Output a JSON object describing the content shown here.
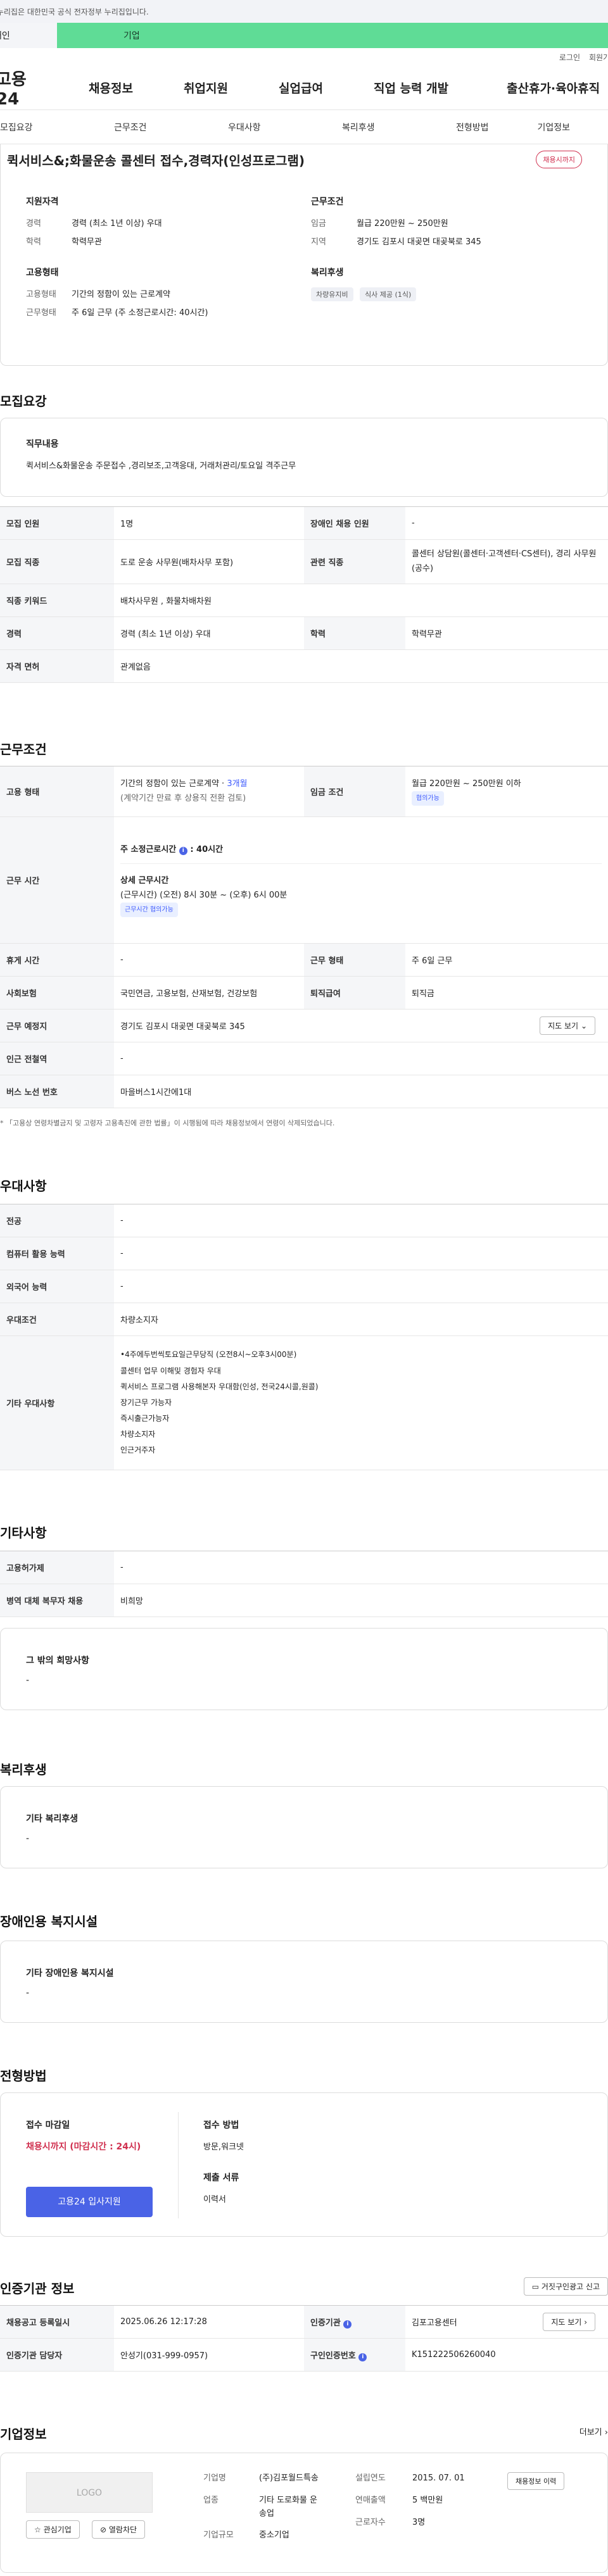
{
  "gov_banner": "이 누리집은 대한민국 공식 전자정부 누리집입니다.",
  "user_tabs": {
    "individual": "개인",
    "corporate": "기업"
  },
  "util_links": [
    "로그인",
    "회원가입"
  ],
  "logo": "고용24",
  "gnb": [
    "채용정보",
    "취업지원",
    "실업급여",
    "직업 능력 개발",
    "출산휴가·육아휴직"
  ],
  "subnav": [
    "모집요강",
    "근무조건",
    "우대사항",
    "복리후생",
    "전형방법",
    "기업정보"
  ],
  "job": {
    "title": "퀵서비스&;화물운송 콜센터 접수,경력자(인성프로그램)",
    "badge": "채용시까지",
    "qual_h": "지원자격",
    "qual": [
      {
        "k": "경력",
        "v": "경력 (최소 1년 이상) 우대"
      },
      {
        "k": "학력",
        "v": "학력무관"
      }
    ],
    "cond_h": "근무조건",
    "cond": [
      {
        "k": "임금",
        "v": "월급 220만원 ~ 250만원"
      },
      {
        "k": "지역",
        "v": "경기도 김포시 대곶면 대곶북로 345"
      }
    ],
    "emp_h": "고용형태",
    "emp": [
      {
        "k": "고용형태",
        "v": "기간의 정함이 있는 근로계약"
      },
      {
        "k": "근무형태",
        "v": "주 6일 근무 (주 소정근로시간: 40시간)"
      }
    ],
    "welfare_h": "복리후생",
    "welfare_chips": [
      "차량유지비",
      "식사 제공 (1식)"
    ]
  },
  "recruit": {
    "title": "모집요강",
    "duty_h": "직무내용",
    "duty": "퀵서비스&화물운송 주문접수 ,경리보조,고객응대, 거래처관리/토요일 격주근무",
    "rows": [
      {
        "k1": "모집 인원",
        "v1": "1명",
        "k2": "장애인 채용 인원",
        "v2": "-"
      },
      {
        "k1": "모집 직종",
        "v1": "도로 운송 사무원(배차사무 포함)",
        "k2": "관련 직종",
        "v2": "콜센터 상담원(콜센터·고객센터·CS센터), 경리 사무원(공수)"
      },
      {
        "k1": "직종 키워드",
        "v1": "배차사무원 , 화물차배차원"
      },
      {
        "k1": "경력",
        "v1": "경력 (최소 1년 이상) 우대",
        "k2": "학력",
        "v2": "학력무관"
      },
      {
        "k1": "자격 면허",
        "v1": "관계없음"
      }
    ]
  },
  "work": {
    "title": "근무조건",
    "emp_type_k": "고용 형태",
    "emp_type_v": "기간의 정함이 있는 근로계약 · ",
    "emp_type_months": "3개월",
    "emp_type_note": "(계약기간 만료 후 상용직 전환 검토)",
    "wage_k": "임금 조건",
    "wage_v": "월급 220만원 ~ 250만원 이하",
    "wage_chip": "협의가능",
    "hours_k": "근무 시간",
    "hours_main": "주 소정근로시간",
    "hours_val": ": 40시간",
    "hours_detail_h": "상세 근무시간",
    "hours_detail": "(근무시간) (오전) 8시 30분 ~ (오후) 6시 00분",
    "hours_chip": "근무시간 협의가능",
    "rest_k": "휴게 시간",
    "rest_v": "-",
    "type_k": "근무 형태",
    "type_v": "주 6일 근무",
    "ins_k": "사회보험",
    "ins_v": "국민연금, 고용보험, 산재보험, 건강보험",
    "sev_k": "퇴직급여",
    "sev_v": "퇴직금",
    "place_k": "근무 예정지",
    "place_v": "경기도 김포시 대곶면 대곶북로 345",
    "map_btn": "지도 보기",
    "station_k": "인근 전철역",
    "station_v": "-",
    "bus_k": "버스 노선 번호",
    "bus_v": "마을버스1시간에1대",
    "notice": "「고용상 연령차별금지 및 고령자 고용촉진에 관한 법률」이 시행됨에 따라 채용정보에서 연령이 삭제되었습니다."
  },
  "pref": {
    "title": "우대사항",
    "rows": [
      {
        "k": "전공",
        "v": "-"
      },
      {
        "k": "컴퓨터 활용 능력",
        "v": "-"
      },
      {
        "k": "외국어 능력",
        "v": "-"
      },
      {
        "k": "우대조건",
        "v": "차량소지자"
      }
    ],
    "etc_k": "기타 우대사항",
    "etc": [
      "•4주에두번씩토요일근무당직 (오전8시~오후3시00분)",
      "콜센터 업무 이해및 경험자 우대",
      "퀵서비스 프로그램 사용해본자 우대함(인성, 전국24시콜,원콜)",
      "장기근무 가능자",
      "즉시출근가능자",
      "차량소지자",
      "인근거주자"
    ]
  },
  "other": {
    "title": "기타사항",
    "rows": [
      {
        "k": "고용허가제",
        "v": "-"
      },
      {
        "k": "병역 대체 복무자 채용",
        "v": "비희망"
      }
    ],
    "hope_h": "그 밖의 희망사항",
    "hope_v": "-"
  },
  "welfare": {
    "title": "복리후생",
    "box_h": "기타 복리후생",
    "box_v": "-"
  },
  "disability": {
    "title": "장애인용 복지시설",
    "box_h": "기타 장애인용 복지시설",
    "box_v": "-"
  },
  "process": {
    "title": "전형방법",
    "deadline_h": "접수 마감일",
    "deadline_v": "채용시까지 (마감시간 : 24시)",
    "apply_btn": "고용24 입사지원",
    "method_h": "접수 방법",
    "method_v": "방문,워크넷",
    "docs_h": "제출 서류",
    "docs_v": "이력서"
  },
  "agency": {
    "title": "인증기관 정보",
    "report_btn": "거짓구인광고 신고",
    "reg_k": "채용공고 등록일시",
    "reg_v": "2025.06.26 12:17:28",
    "org_k": "인증기관",
    "org_v": "김포고용센터",
    "map_btn": "지도 보기",
    "mgr_k": "인증기관 담당자",
    "mgr_v": "안성기(031-999-0957)",
    "no_k": "구인인증번호",
    "no_v": "K151222506260040"
  },
  "company": {
    "title": "기업정보",
    "more": "더보기",
    "logo": "LOGO",
    "fav_btn": "관심기업",
    "block_btn": "열람차단",
    "name_k": "기업명",
    "name_v": "(주)김포월드특송",
    "industry_k": "업종",
    "industry_v": "기타 도로화물 운송업",
    "size_k": "기업규모",
    "size_v": "중소기업",
    "est_k": "설립연도",
    "est_v": "2015. 07. 01",
    "sales_k": "연매출액",
    "sales_v": "5 백만원",
    "emp_k": "근로자수",
    "emp_v": "3명",
    "jobs_btn": "채용정보 이력"
  },
  "colors": {
    "accent": "#4a63e6",
    "corp_tab": "#5fdc96",
    "badge": "#d0304f",
    "deadline": "#d0304f"
  }
}
